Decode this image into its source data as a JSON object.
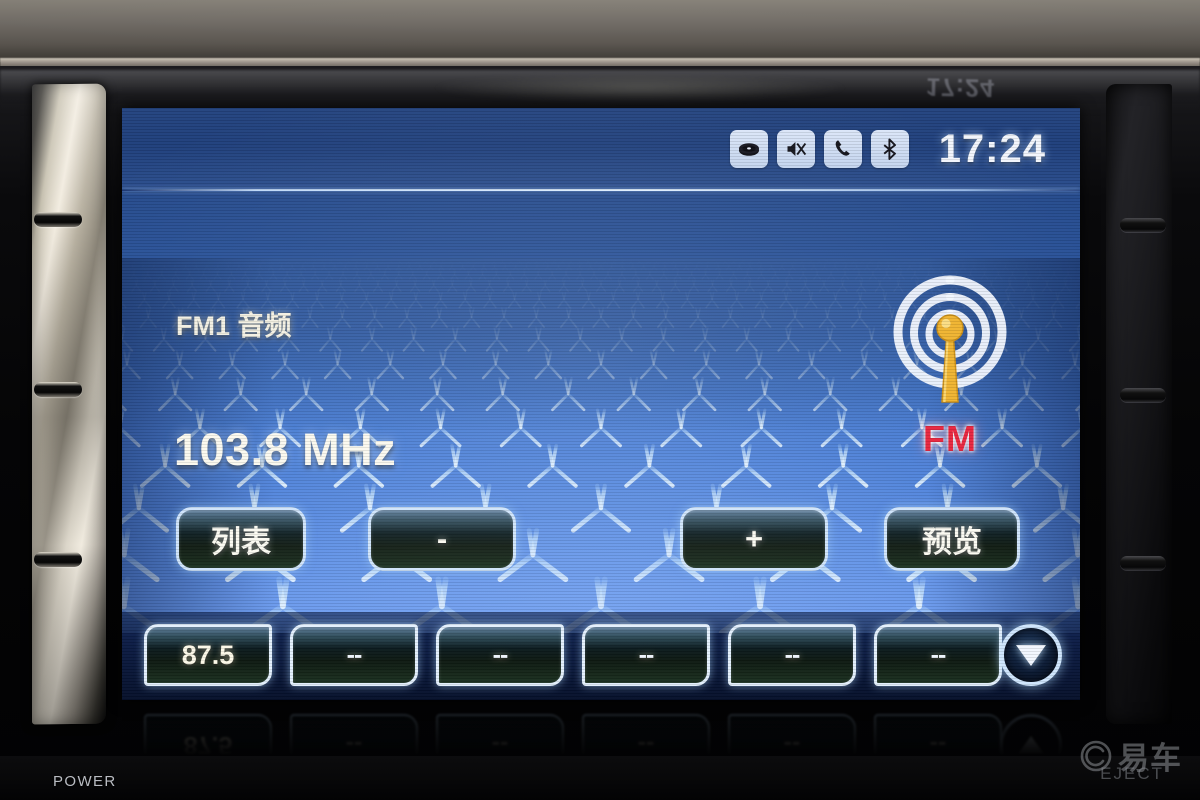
{
  "device": {
    "power_label": "POWER",
    "eject_label": "EJECT",
    "watermark_text": "易车"
  },
  "screen": {
    "statusbar": {
      "icons": [
        {
          "name": "disc-icon",
          "glyph": "disc"
        },
        {
          "name": "mute-icon",
          "glyph": "mute"
        },
        {
          "name": "phone-icon",
          "glyph": "phone"
        },
        {
          "name": "bluetooth-icon",
          "glyph": "bluetooth"
        }
      ],
      "clock": "17:24"
    },
    "source_label": "FM1 音频",
    "frequency": "103.8 MHz",
    "band_badge": {
      "label": "FM",
      "label_color": "#e8203a",
      "tower_color": "#f0b22a"
    },
    "controls": [
      {
        "name": "list-button",
        "label": "列表"
      },
      {
        "name": "tune-down-button",
        "label": "-"
      },
      {
        "name": "tune-up-button",
        "label": "+"
      },
      {
        "name": "preview-button",
        "label": "预览"
      }
    ],
    "presets": [
      {
        "name": "preset-1",
        "label": "87.5",
        "set": true
      },
      {
        "name": "preset-2",
        "label": "--",
        "set": false
      },
      {
        "name": "preset-3",
        "label": "--",
        "set": false
      },
      {
        "name": "preset-4",
        "label": "--",
        "set": false
      },
      {
        "name": "preset-5",
        "label": "--",
        "set": false
      },
      {
        "name": "preset-6",
        "label": "--",
        "set": false
      }
    ],
    "preset_scroll": {
      "name": "preset-page-down-button",
      "glyph": "chevron-down"
    },
    "reflected_clock": "17:24",
    "colors": {
      "screen_blue": "#2f60ac",
      "grid_line": "#bfe0ff",
      "accent_yellow": "#f0b22a",
      "accent_red": "#e8203a",
      "button_border": "#cfe4fb"
    }
  }
}
